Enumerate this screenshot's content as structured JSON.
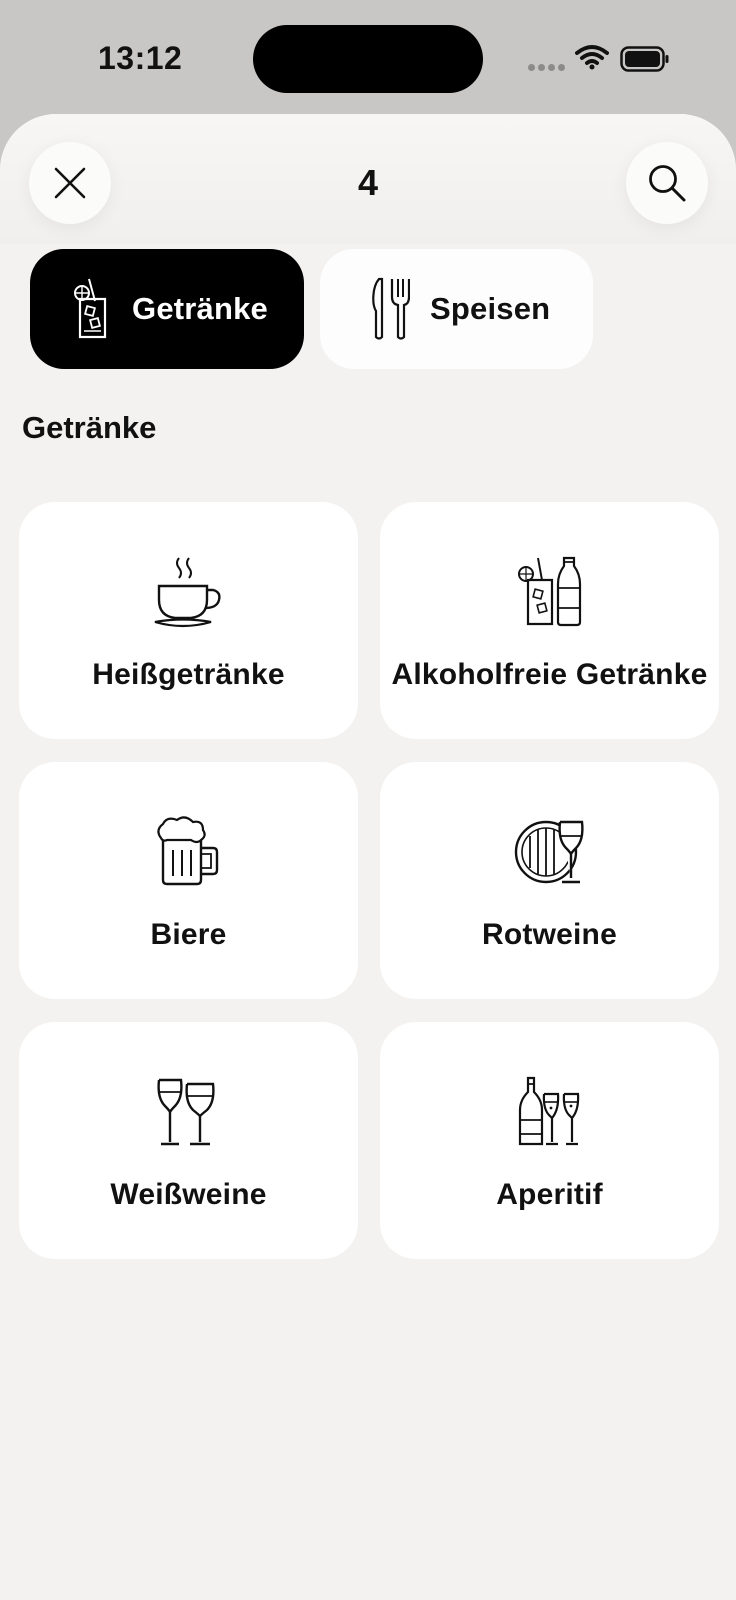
{
  "status_bar": {
    "time": "13:12"
  },
  "header": {
    "title": "4",
    "close_icon": "close-icon",
    "search_icon": "search-icon"
  },
  "tabs": [
    {
      "label": "Getränke",
      "icon": "cocktail-glass-icon",
      "active": true
    },
    {
      "label": "Speisen",
      "icon": "knife-fork-icon",
      "active": false
    }
  ],
  "section": {
    "title": "Getränke"
  },
  "categories": [
    {
      "label": "Heißgetränke",
      "icon": "coffee-cup-icon"
    },
    {
      "label": "Alkoholfreie Getränke",
      "icon": "soft-drinks-icon"
    },
    {
      "label": "Biere",
      "icon": "beer-mug-icon"
    },
    {
      "label": "Rotweine",
      "icon": "wine-barrel-glass-icon"
    },
    {
      "label": "Weißweine",
      "icon": "wine-glasses-icon"
    },
    {
      "label": "Aperitif",
      "icon": "champagne-bottle-icon"
    }
  ],
  "colors": {
    "active_tab": "#000000",
    "background": "#f3f2f1",
    "card": "#ffffff"
  }
}
